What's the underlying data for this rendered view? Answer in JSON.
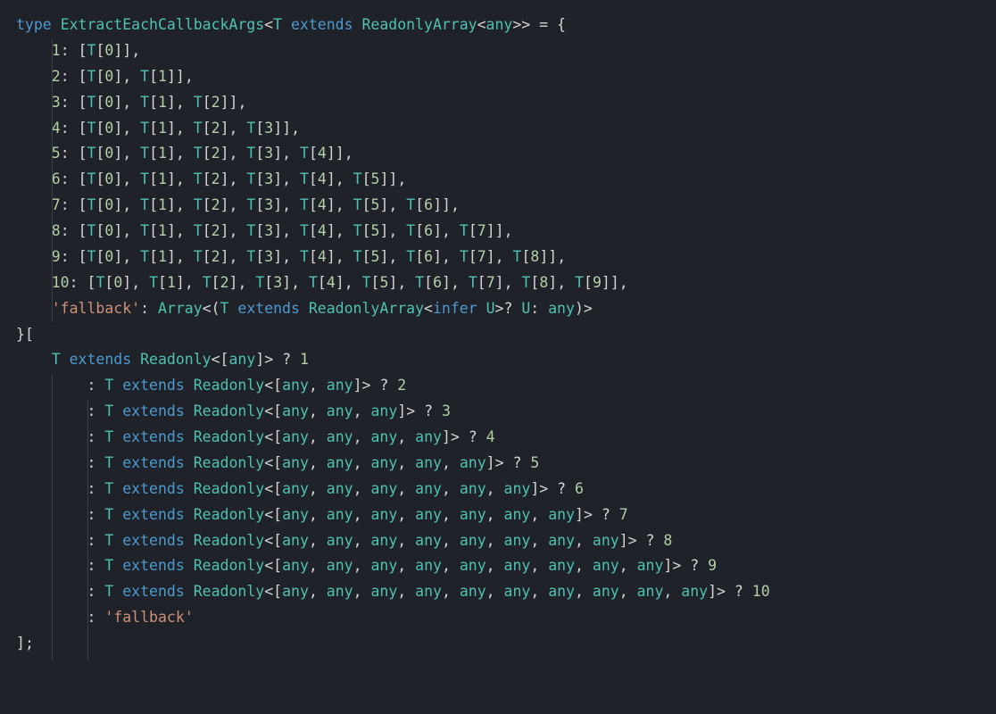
{
  "code": {
    "keyword_type": "type",
    "type_name": "ExtractEachCallbackArgs",
    "keyword_extends": "extends",
    "type_ReadonlyArray": "ReadonlyArray",
    "type_Readonly": "Readonly",
    "type_Array": "Array",
    "keyword_infer": "infer",
    "tvar_T": "T",
    "tvar_U": "U",
    "any": "any",
    "q": "?",
    "colon": ":",
    "eq": "=",
    "lt": "<",
    "gt": ">",
    "lparen": "(",
    "rparen": ")",
    "lbrace": "{",
    "rbrace": "}",
    "lbracket": "[",
    "rbracket": "]",
    "comma": ",",
    "semi": ";",
    "str_fallback": "'fallback'",
    "n1": "1",
    "n2": "2",
    "n3": "3",
    "n4": "4",
    "n5": "5",
    "n6": "6",
    "n7": "7",
    "n8": "8",
    "n9": "9",
    "n10": "10",
    "i0": "0",
    "i1": "1",
    "i2": "2",
    "i3": "3",
    "i4": "4",
    "i5": "5",
    "i6": "6",
    "i7": "7",
    "i8": "8",
    "i9": "9"
  }
}
